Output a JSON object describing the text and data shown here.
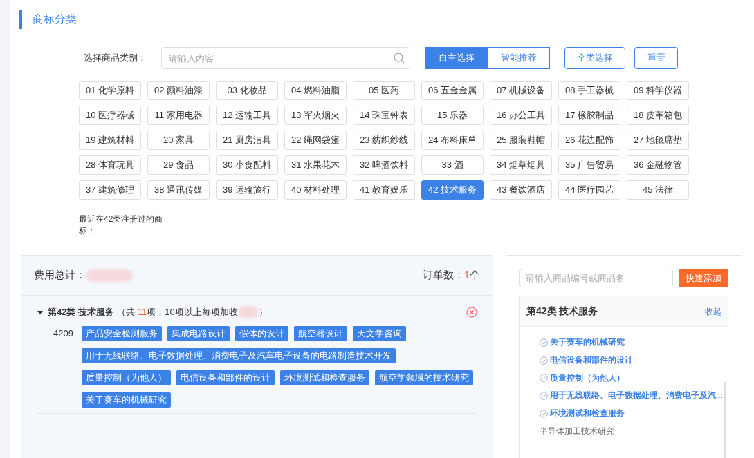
{
  "section_title": "商标分类",
  "filter": {
    "label": "选择商品类别：",
    "placeholder": "请输入内容",
    "modes": [
      {
        "label": "自主选择",
        "selected": true
      },
      {
        "label": "智能推荐",
        "selected": false
      }
    ],
    "buttons": [
      "全类选择",
      "重置"
    ]
  },
  "categories": [
    {
      "label": "01 化学原料",
      "selected": false
    },
    {
      "label": "02 颜料油漆",
      "selected": false
    },
    {
      "label": "03 化妆品",
      "selected": false
    },
    {
      "label": "04 燃料油脂",
      "selected": false
    },
    {
      "label": "05 医药",
      "selected": false
    },
    {
      "label": "06 五金金属",
      "selected": false
    },
    {
      "label": "07 机械设备",
      "selected": false
    },
    {
      "label": "08 手工器械",
      "selected": false
    },
    {
      "label": "09 科学仪器",
      "selected": false
    },
    {
      "label": "10 医疗器械",
      "selected": false
    },
    {
      "label": "11 家用电器",
      "selected": false
    },
    {
      "label": "12 运输工具",
      "selected": false
    },
    {
      "label": "13 军火烟火",
      "selected": false
    },
    {
      "label": "14 珠宝钟表",
      "selected": false
    },
    {
      "label": "15 乐器",
      "selected": false
    },
    {
      "label": "16 办公工具",
      "selected": false
    },
    {
      "label": "17 橡胶制品",
      "selected": false
    },
    {
      "label": "18 皮革箱包",
      "selected": false
    },
    {
      "label": "19 建筑材料",
      "selected": false
    },
    {
      "label": "20 家具",
      "selected": false
    },
    {
      "label": "21 厨房洁具",
      "selected": false
    },
    {
      "label": "22 绳网袋篷",
      "selected": false
    },
    {
      "label": "23 纺织纱线",
      "selected": false
    },
    {
      "label": "24 布料床单",
      "selected": false
    },
    {
      "label": "25 服装鞋帽",
      "selected": false
    },
    {
      "label": "26 花边配饰",
      "selected": false
    },
    {
      "label": "27 地毯席垫",
      "selected": false
    },
    {
      "label": "28 体育玩具",
      "selected": false
    },
    {
      "label": "29 食品",
      "selected": false
    },
    {
      "label": "30 小食配料",
      "selected": false
    },
    {
      "label": "31 水果花木",
      "selected": false
    },
    {
      "label": "32 啤酒饮料",
      "selected": false
    },
    {
      "label": "33 酒",
      "selected": false
    },
    {
      "label": "34 烟草烟具",
      "selected": false
    },
    {
      "label": "35 广告贸易",
      "selected": false
    },
    {
      "label": "36 金融物管",
      "selected": false
    },
    {
      "label": "37 建筑修理",
      "selected": false
    },
    {
      "label": "38 通讯传媒",
      "selected": false
    },
    {
      "label": "39 运输旅行",
      "selected": false
    },
    {
      "label": "40 材料处理",
      "selected": false
    },
    {
      "label": "41 教育娱乐",
      "selected": false
    },
    {
      "label": "42 技术服务",
      "selected": true
    },
    {
      "label": "43 餐饮酒店",
      "selected": false
    },
    {
      "label": "44 医疗园艺",
      "selected": false
    },
    {
      "label": "45 法律",
      "selected": false
    }
  ],
  "recent_note": "最近在42类注册过的商标：",
  "order": {
    "total_label": "费用总计：",
    "count_label": "订单数：",
    "count": "1",
    "count_unit": "个",
    "group": {
      "expanded": true,
      "title": "第42类 技术服务",
      "summary_open": "（共 ",
      "item_count": "11",
      "summary_rest": "项，10项以上每项加收",
      "summary_close": "）",
      "code": "4209",
      "items": [
        "产品安全检测服务",
        "集成电路设计",
        "假体的设计",
        "航空器设计",
        "天文学咨询",
        "用于无线联络、电子数据处理、消费电子及汽车电子设备的电路制造技术开发",
        "质量控制（为他人）",
        "电信设备和部件的设计",
        "环境测试和检查服务",
        "航空学领域的技术研究",
        "关于赛车的机械研究"
      ]
    }
  },
  "quick_add": {
    "placeholder": "请输入商品编号或商品名",
    "button": "快速添加",
    "panel_title": "第42类 技术服务",
    "collapse": "收起",
    "items": [
      {
        "label": "关于赛车的机械研究",
        "selected": true
      },
      {
        "label": "电信设备和部件的设计",
        "selected": true
      },
      {
        "label": "质量控制（为他人）",
        "selected": true
      },
      {
        "label": "用于无线联络、电子数据处理、消费电子及汽...",
        "selected": true
      },
      {
        "label": "环境测试和检查服务",
        "selected": true
      },
      {
        "label": "半导体加工技术研究",
        "selected": false
      }
    ]
  }
}
